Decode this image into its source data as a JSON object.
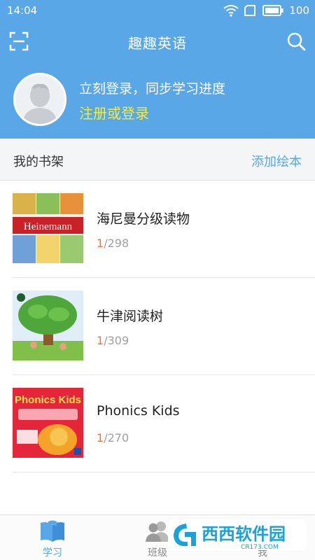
{
  "status_bar": {
    "time": "14:04",
    "battery": "100"
  },
  "header": {
    "title": "趣趣英语"
  },
  "profile": {
    "hint": "立刻登录，同步学习进度",
    "login_link": "注册或登录"
  },
  "shelf": {
    "title": "我的书架",
    "add_label": "添加绘本",
    "books": [
      {
        "name": "海尼曼分级读物",
        "current": "1",
        "total": "/298",
        "cover_text": "Heinemann"
      },
      {
        "name": "牛津阅读树",
        "current": "1",
        "total": "/309"
      },
      {
        "name": "Phonics Kids",
        "current": "1",
        "total": "/270",
        "cover_text": "Phonics Kids"
      }
    ]
  },
  "tabs": [
    {
      "label": "学习"
    },
    {
      "label": "班级"
    },
    {
      "label": "我"
    }
  ],
  "watermark": {
    "text": "西西软件园",
    "subtext": "CR173.COM"
  },
  "colors": {
    "primary": "#5aa7e8",
    "login_link": "#f2ee3c",
    "progress_current": "#e8743b"
  }
}
